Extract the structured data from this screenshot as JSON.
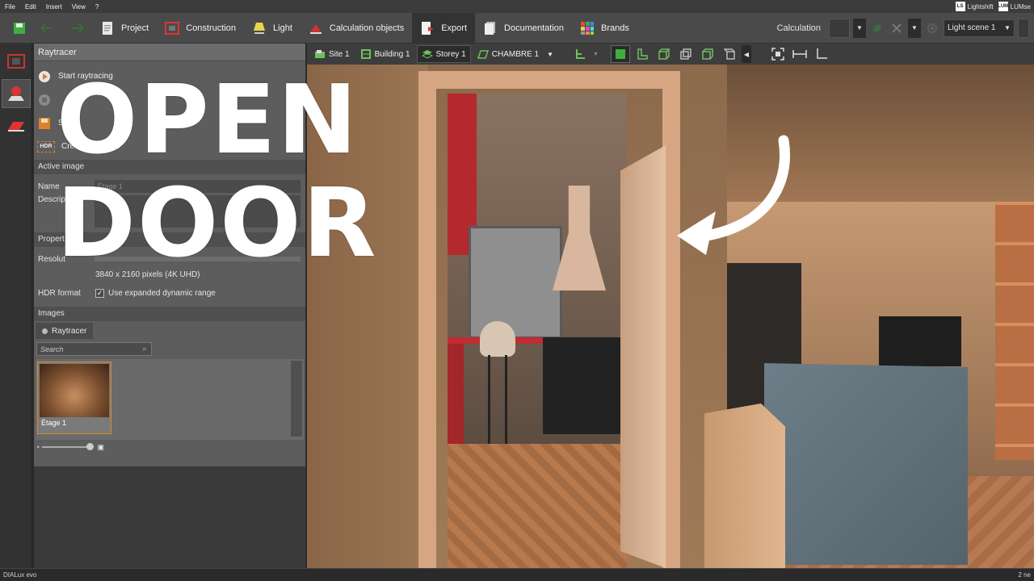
{
  "menu": [
    "File",
    "Edit",
    "Insert",
    "View",
    "?"
  ],
  "badges": {
    "lightshift_box": "LS",
    "lightshift": "Lightshift",
    "lumsearch_box": "LUM",
    "lumsearch": "LUMse"
  },
  "toolbar": {
    "tabs": [
      "Project",
      "Construction",
      "Light",
      "Calculation objects",
      "Export",
      "Documentation",
      "Brands"
    ],
    "active_tab": "Export",
    "calculation_label": "Calculation",
    "light_scene": "Light scene 1"
  },
  "raytracer": {
    "title": "Raytracer",
    "actions": [
      "Start raytracing",
      "",
      "S",
      "Crea"
    ],
    "hdr_badge": "HDR",
    "action_tail": "..."
  },
  "active_image": {
    "section": "Active image",
    "name_label": "Name",
    "name_value": "Étage 1",
    "description_label": "Descrip"
  },
  "properties": {
    "section": "Propert",
    "resolution_label": "Resolut",
    "resolution_value": "3840 x 2160 pixels (4K UHD)",
    "hdr_label": "HDR format",
    "hdr_checkbox": "Use expanded dynamic range",
    "hdr_checked": true
  },
  "images": {
    "section": "Images",
    "tab": "Raytracer",
    "search_placeholder": "Search",
    "thumbnail_caption": "Étage 1"
  },
  "viewport": {
    "crumbs": [
      "Site 1",
      "Building 1",
      "Storey 1",
      "CHAMBRE 1"
    ],
    "active_crumb": "Storey 1"
  },
  "overlay": {
    "line1": "OPEN",
    "line2": "DOOR"
  },
  "status": {
    "app_name": "DIALux evo",
    "right_text": "2 ne"
  },
  "colors": {
    "accent_orange": "#d98a2a",
    "door_red": "#b3292e",
    "panel_bg": "#5d5d5d",
    "green_icon": "#3fae3f"
  }
}
